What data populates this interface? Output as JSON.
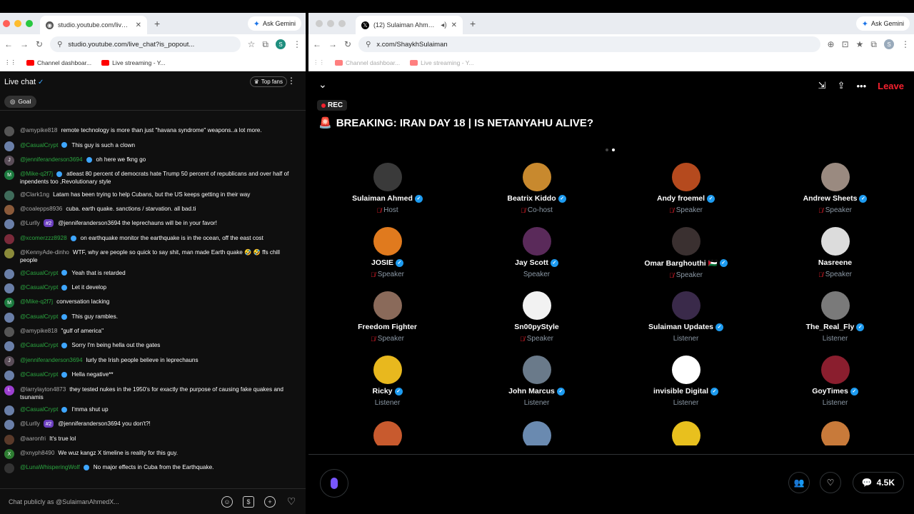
{
  "left_window": {
    "tab_title": "studio.youtube.com/live_chat",
    "new_tab": "+",
    "ask_gemini": "Ask Gemini",
    "url": "studio.youtube.com/live_chat?is_popout...",
    "bookmarks": [
      "Channel dashboar...",
      "Live streaming - Y..."
    ],
    "profile": "S"
  },
  "chat": {
    "title": "Live chat",
    "top_fans": "Top fans",
    "goal": "Goal",
    "placeholder": "Chat publicly as @SulaimanAhmedX...",
    "messages": [
      {
        "author": "@amypike818",
        "text": "remote technology is more than just \"havana syndrome\" weapons..a lot more.",
        "avatar": "#555",
        "initial": "",
        "green": false,
        "badge": false,
        "rank": ""
      },
      {
        "author": "@CasualCrypt",
        "text": "This guy is such a clown",
        "avatar": "#6a7fa8",
        "initial": "",
        "green": true,
        "badge": true,
        "rank": ""
      },
      {
        "author": "@jenniferanderson3694",
        "text": "oh here we fkng go",
        "avatar": "#5a4d58",
        "initial": "J",
        "green": true,
        "badge": true,
        "rank": ""
      },
      {
        "author": "@Mike-q2f7j",
        "text": "atleast 80 percent of democrats hate Trump 50 percent of republicans and over half of inpendents too ,Revolutionary style",
        "avatar": "#1b7a3e",
        "initial": "M",
        "green": true,
        "badge": true,
        "rank": ""
      },
      {
        "author": "@Clark1ng",
        "text": "Latam has been trying to help Cubans, but the US keeps getting in their way",
        "avatar": "#3f6b5a",
        "initial": "",
        "green": false,
        "badge": false,
        "rank": ""
      },
      {
        "author": "@coalepps8936",
        "text": "cuba. earth quake. sanctions / starvation. all bad.ti",
        "avatar": "#8a5a3a",
        "initial": "",
        "green": false,
        "badge": false,
        "rank": ""
      },
      {
        "author": "@Lurlly",
        "text": "@jenniferanderson3694 the leprechauns will be in your favor!",
        "avatar": "#6a7fa8",
        "initial": "",
        "green": false,
        "badge": false,
        "rank": "#2"
      },
      {
        "author": "@xcomerzzz8928",
        "text": "on earthquake monitor the earthquake is in the ocean, off the east cost",
        "avatar": "#7a2a3a",
        "initial": "",
        "green": true,
        "badge": true,
        "rank": ""
      },
      {
        "author": "@KennyAde-dinho",
        "text": "WTF, why are people so quick to say shit, man made Earth quake 🤣 🤣 ffs chill people",
        "avatar": "#8a8a3a",
        "initial": "",
        "green": false,
        "badge": false,
        "rank": ""
      },
      {
        "author": "@CasualCrypt",
        "text": "Yeah that is retarded",
        "avatar": "#6a7fa8",
        "initial": "",
        "green": true,
        "badge": true,
        "rank": ""
      },
      {
        "author": "@CasualCrypt",
        "text": "Let it develop",
        "avatar": "#6a7fa8",
        "initial": "",
        "green": true,
        "badge": true,
        "rank": ""
      },
      {
        "author": "@Mike-q2f7j",
        "text": "conversation lacking",
        "avatar": "#1b7a3e",
        "initial": "M",
        "green": true,
        "badge": false,
        "rank": ""
      },
      {
        "author": "@CasualCrypt",
        "text": "This guy rambles.",
        "avatar": "#6a7fa8",
        "initial": "",
        "green": true,
        "badge": true,
        "rank": ""
      },
      {
        "author": "@amypike818",
        "text": "\"gulf of america\"",
        "avatar": "#555",
        "initial": "",
        "green": false,
        "badge": false,
        "rank": ""
      },
      {
        "author": "@CasualCrypt",
        "text": "Sorry I'm being hella out the gates",
        "avatar": "#6a7fa8",
        "initial": "",
        "green": true,
        "badge": true,
        "rank": ""
      },
      {
        "author": "@jenniferanderson3694",
        "text": "lurly the Irish people believe in leprechauns",
        "avatar": "#5a4d58",
        "initial": "J",
        "green": true,
        "badge": false,
        "rank": ""
      },
      {
        "author": "@CasualCrypt",
        "text": "Hella negative**",
        "avatar": "#6a7fa8",
        "initial": "",
        "green": true,
        "badge": true,
        "rank": ""
      },
      {
        "author": "@larrylayton4873",
        "text": "they tested nukes in the 1950's for exactly the purpose of causing fake quakes and tsunamis",
        "avatar": "#9c3fd0",
        "initial": "L",
        "green": false,
        "badge": false,
        "rank": ""
      },
      {
        "author": "@CasualCrypt",
        "text": "I'mma shut up",
        "avatar": "#6a7fa8",
        "initial": "",
        "green": true,
        "badge": true,
        "rank": ""
      },
      {
        "author": "@Lurlly",
        "text": "@jenniferanderson3694 you don't?!",
        "avatar": "#6a7fa8",
        "initial": "",
        "green": false,
        "badge": false,
        "rank": "#2"
      },
      {
        "author": "@aaronfri",
        "text": "It's true lol",
        "avatar": "#5a3a2a",
        "initial": "",
        "green": false,
        "badge": false,
        "rank": ""
      },
      {
        "author": "@xnyph8490",
        "text": "We wuz kangz X timeline is reality for this guy.",
        "avatar": "#2e7d32",
        "initial": "X",
        "green": false,
        "badge": false,
        "rank": ""
      },
      {
        "author": "@LunaWhisperingWolf",
        "text": "No major effects in Cuba from the Earthquake.",
        "avatar": "#333",
        "initial": "",
        "green": true,
        "badge": true,
        "rank": ""
      }
    ]
  },
  "right_window": {
    "tab_title": "(12) Sulaiman Ahmed (@S",
    "new_tab": "+",
    "ask_gemini": "Ask Gemini",
    "url": "x.com/ShaykhSulaiman",
    "bookmarks": [
      "Channel dashboar...",
      "Live streaming - Y..."
    ],
    "profile": "S"
  },
  "space": {
    "rec": "REC",
    "title_emoji": "🚨",
    "title": "BREAKING: IRAN DAY 18 | IS NETANYAHU ALIVE?",
    "leave": "Leave",
    "count": "4.5K",
    "participants": [
      {
        "name": "Sulaiman Ahmed",
        "role": "Host",
        "verified": true,
        "muted": true,
        "color": "#3a3a3a"
      },
      {
        "name": "Beatrix Kiddo",
        "role": "Co-host",
        "verified": true,
        "muted": true,
        "color": "#c8892e"
      },
      {
        "name": "Andy froemel",
        "role": "Speaker",
        "verified": true,
        "muted": true,
        "color": "#b54a1e"
      },
      {
        "name": "Andrew Sheets",
        "role": "Speaker",
        "verified": true,
        "muted": true,
        "color": "#9a8a80"
      },
      {
        "name": "JOSIE",
        "role": "Speaker",
        "verified": true,
        "muted": true,
        "color": "#e07a1e"
      },
      {
        "name": "Jay Scott",
        "role": "Speaker",
        "verified": true,
        "muted": false,
        "color": "#5a2a5a"
      },
      {
        "name": "Omar Barghouthi 🇵🇸",
        "role": "Speaker",
        "verified": true,
        "muted": true,
        "color": "#3a3030"
      },
      {
        "name": "Nasreene",
        "role": "Speaker",
        "verified": false,
        "muted": true,
        "color": "#dcdcdc"
      },
      {
        "name": "Freedom Fighter",
        "role": "Speaker",
        "verified": false,
        "muted": true,
        "color": "#8a6a5a"
      },
      {
        "name": "Sn00pyStyle",
        "role": "Speaker",
        "verified": false,
        "muted": true,
        "color": "#f2f2f2"
      },
      {
        "name": "Sulaiman Updates",
        "role": "Listener",
        "verified": true,
        "muted": false,
        "color": "#3a2a4a"
      },
      {
        "name": "The_Real_Fly",
        "role": "Listener",
        "verified": true,
        "muted": false,
        "color": "#7a7a7a"
      },
      {
        "name": "Ricky",
        "role": "Listener",
        "verified": true,
        "muted": false,
        "color": "#e8b81e"
      },
      {
        "name": "John Marcus",
        "role": "Listener",
        "verified": true,
        "muted": false,
        "color": "#6a7a8a"
      },
      {
        "name": "invisible Digital",
        "role": "Listener",
        "verified": true,
        "muted": false,
        "color": "#ffffff"
      },
      {
        "name": "GoyTimes",
        "role": "Listener",
        "verified": true,
        "muted": false,
        "color": "#8a1e2e"
      }
    ],
    "cut_row_colors": [
      "#c85a2e",
      "#6a8ab0",
      "#e8c01e",
      "#c87a3a"
    ]
  }
}
